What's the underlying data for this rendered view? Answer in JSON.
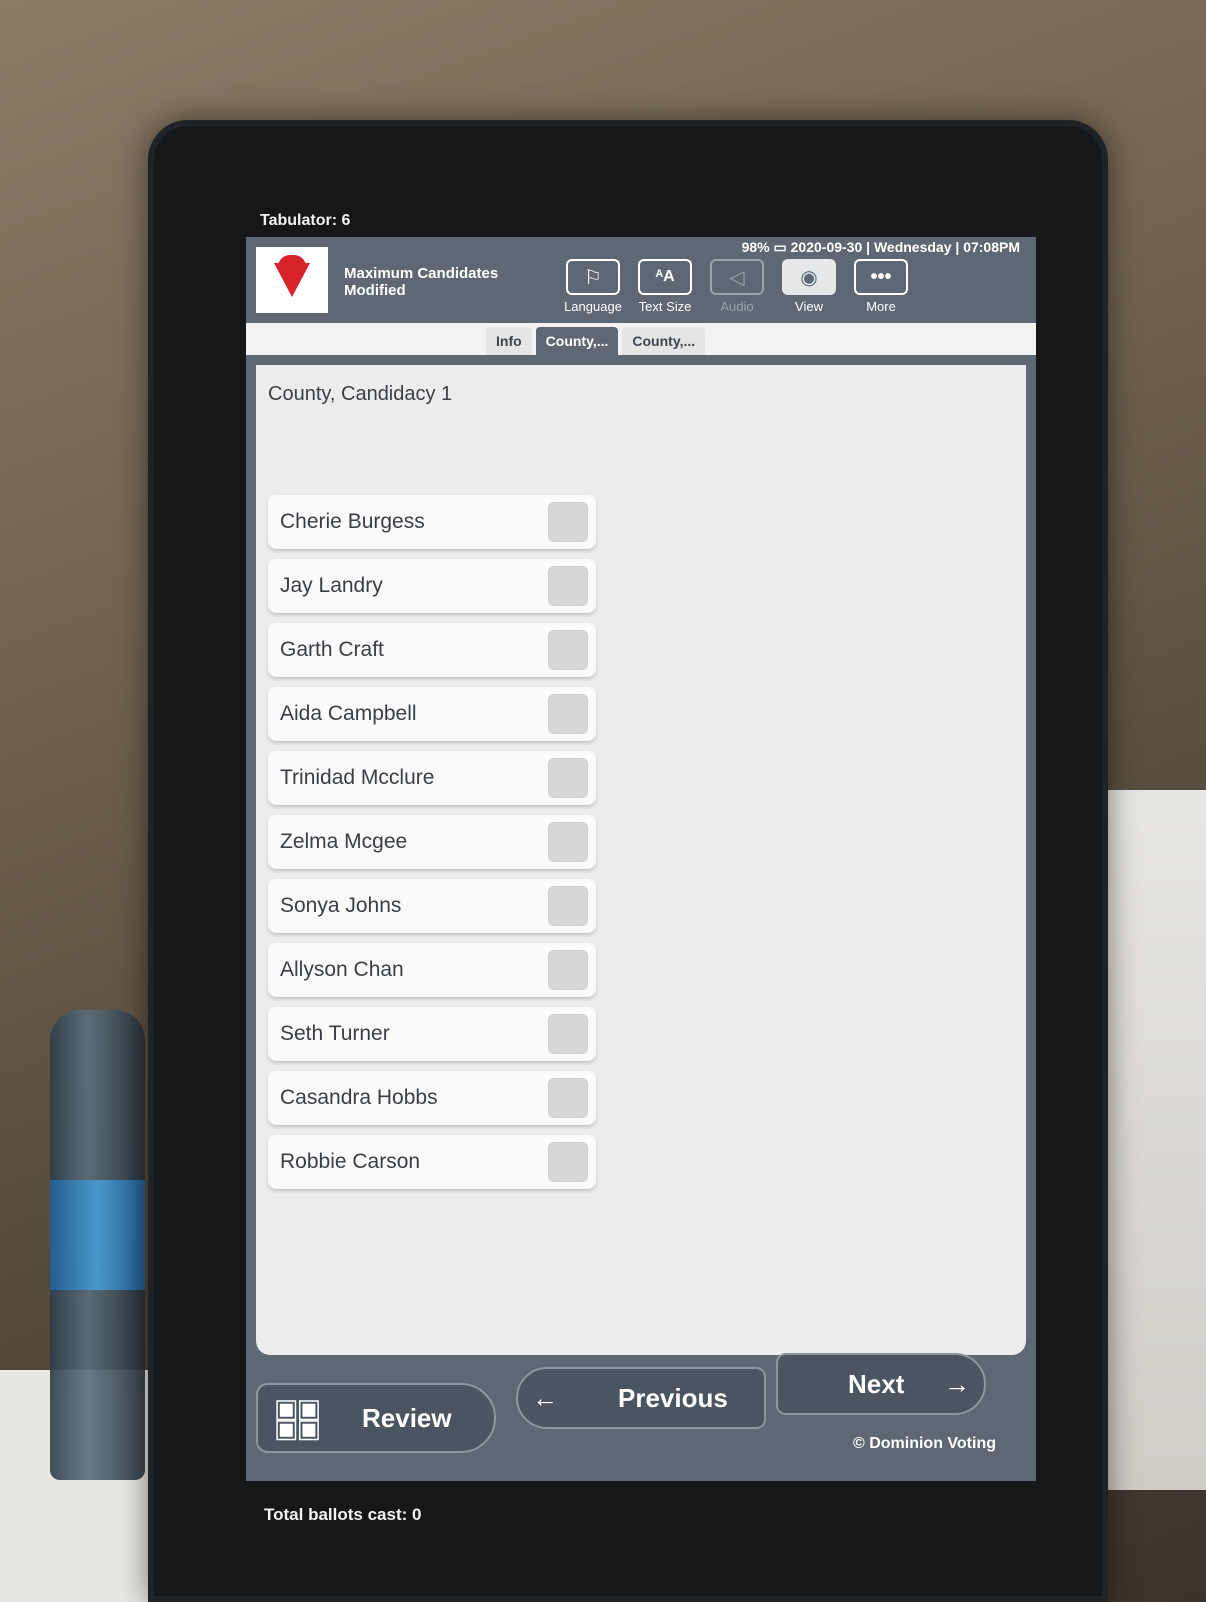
{
  "device": {
    "tabulator": "Tabulator: 6",
    "total_ballots": "Total ballots cast: 0"
  },
  "status": {
    "battery": "98%",
    "datetime": "2020-09-30 | Wednesday | 07:08PM"
  },
  "header": {
    "election_title": "Maximum Candidates Modified",
    "tools": [
      {
        "label": "Language",
        "icon": "flag-icon",
        "state": "normal"
      },
      {
        "label": "Text Size",
        "icon": "text-size-icon",
        "state": "normal"
      },
      {
        "label": "Audio",
        "icon": "speaker-icon",
        "state": "disabled"
      },
      {
        "label": "View",
        "icon": "eye-icon",
        "state": "active"
      },
      {
        "label": "More",
        "icon": "more-icon",
        "state": "normal"
      }
    ]
  },
  "tabs": [
    {
      "label": "Info",
      "active": false
    },
    {
      "label": "County,...",
      "active": true
    },
    {
      "label": "County,...",
      "active": false
    }
  ],
  "contest": {
    "title": "County, Candidacy 1",
    "candidates": [
      {
        "name": "Cherie Burgess",
        "selected": false
      },
      {
        "name": "Jay Landry",
        "selected": false
      },
      {
        "name": "Garth Craft",
        "selected": false
      },
      {
        "name": "Aida Campbell",
        "selected": false
      },
      {
        "name": "Trinidad Mcclure",
        "selected": false
      },
      {
        "name": "Zelma Mcgee",
        "selected": false
      },
      {
        "name": "Sonya Johns",
        "selected": false
      },
      {
        "name": "Allyson Chan",
        "selected": false
      },
      {
        "name": "Seth Turner",
        "selected": false
      },
      {
        "name": "Casandra Hobbs",
        "selected": false
      },
      {
        "name": "Robbie Carson",
        "selected": false
      }
    ]
  },
  "nav": {
    "review": "Review",
    "previous": "Previous",
    "next": "Next",
    "copyright": "© Dominion Voting"
  },
  "colors": {
    "header": "#5d6874",
    "brand_red": "#d8232a",
    "background": "#ececec"
  }
}
